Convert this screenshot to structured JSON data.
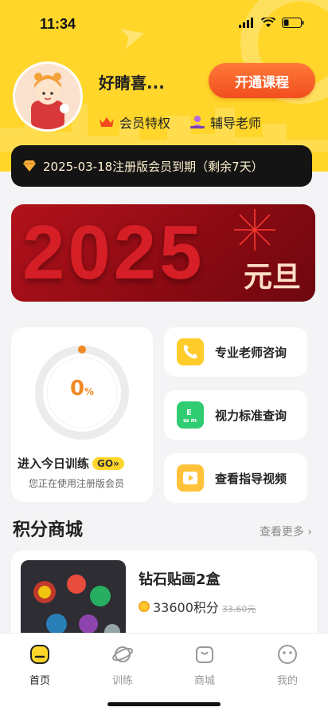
{
  "status": {
    "time": "11:34"
  },
  "profile": {
    "name": "好睛喜...",
    "open_course_label": "开通课程",
    "perks": [
      {
        "label": "会员特权",
        "icon": "crown-icon"
      },
      {
        "label": "辅导老师",
        "icon": "teacher-icon"
      }
    ]
  },
  "membership": {
    "expire_text": "2025-03-18注册版会员到期（剩余7天）"
  },
  "banner": {
    "year": "2025",
    "label": "元旦"
  },
  "training": {
    "progress_value": "0",
    "progress_unit": "%",
    "progress_fraction": 0,
    "title": "进入今日训练",
    "go_label": "GO»",
    "subtitle": "您正在使用注册版会员"
  },
  "services": [
    {
      "label": "专业老师咨询",
      "icon": "phone-icon",
      "color": "#ffcc2c"
    },
    {
      "label": "视力标准查询",
      "icon": "eye-chart-icon",
      "color": "#2fcc71"
    },
    {
      "label": "查看指导视频",
      "icon": "play-icon",
      "color": "#ffc23a"
    }
  ],
  "shop": {
    "title": "积分商城",
    "see_more": "查看更多 ›",
    "product": {
      "name": "钻石贴画2盒",
      "points": "33600积分",
      "old_price": "33.60元"
    }
  },
  "tabs": [
    {
      "label": "首页",
      "icon": "home-icon",
      "active": true
    },
    {
      "label": "训练",
      "icon": "planet-icon",
      "active": false
    },
    {
      "label": "商城",
      "icon": "shopping-bag-icon",
      "active": false
    },
    {
      "label": "我的",
      "icon": "smiley-icon",
      "active": false
    }
  ],
  "colors": {
    "accent": "#ffd629",
    "cta": "#f24e1e",
    "progress": "#f08a25"
  }
}
